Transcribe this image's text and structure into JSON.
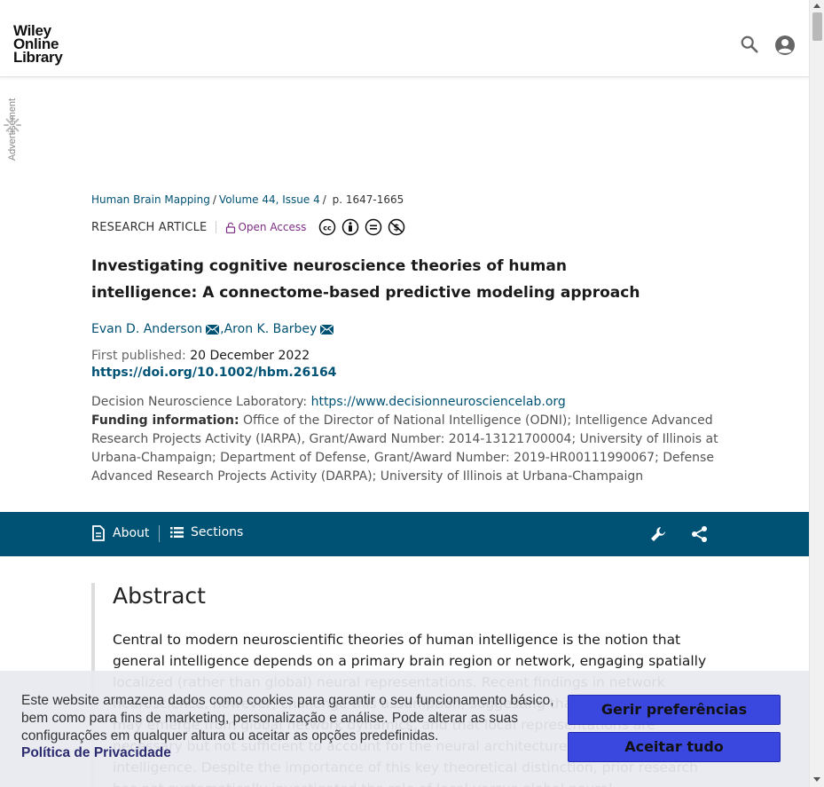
{
  "header": {
    "logo_lines": [
      "Wiley",
      "Online",
      "Library"
    ],
    "search_icon": "search-icon",
    "user_icon": "user-account-icon"
  },
  "ad": {
    "label": "Advertisement"
  },
  "article": {
    "breadcrumb": {
      "journal": "Human Brain Mapping",
      "volume": "Volume 44, Issue 4",
      "pages": "p. 1647-1665"
    },
    "type": "RESEARCH ARTICLE",
    "open_access": "Open Access",
    "license_icons": [
      "cc-icon",
      "by-icon",
      "nd-icon",
      "nc-icon"
    ],
    "title": "Investigating cognitive neuroscience theories of human intelligence: A connectome-based predictive modeling approach",
    "authors": [
      {
        "name": "Evan D. Anderson",
        "sep": ""
      },
      {
        "name": "Aron K. Barbey",
        "sep": ", "
      }
    ],
    "first_published_label": "First published: ",
    "first_published": "20 December 2022",
    "doi": "https://doi.org/10.1002/hbm.26164",
    "affiliation_label": "Decision Neuroscience Laboratory: ",
    "affiliation_url": "https://www.decisionneurosciencelab.org",
    "funding_label": "Funding information:",
    "funding_text": " Office of the Director of National Intelligence (ODNI); Intelligence Advanced Research Projects Activity (IARPA), Grant/Award Number: 2014-13121700004; University of Illinois at Urbana-Champaign; Department of Defense, Grant/Award Number: 2019-HR00111990067; Defense Advanced Research Projects Activity (DARPA); University of Illinois at Urbana-Champaign"
  },
  "section_bar": {
    "about": "About",
    "sections": "Sections",
    "tools_icon": "wrench-icon",
    "share_icon": "share-icon"
  },
  "abstract": {
    "heading": "Abstract",
    "text": "Central to modern neuroscientific theories of human intelligence is the notion that general intelligence depends on a primary brain region or network, engaging spatially localized (rather than global) neural representations. Recent findings in network neuroscience, however, challenge this assumption, suggesting that general intelligence may emerge from global network dynamics, and that local representations are necessary but not sufficient to account for the neural architecture of human intelligence. Despite the importance of this key theoretical distinction, prior research has not systematically investigated the role of local versus global neural representations in predicting general intelligence."
  },
  "cookie": {
    "text": "Este website armazena dados como cookies para garantir o seu funcionamento básico, bem como para fins de marketing, personalização e análise. Pode alterar as suas configurações em qualquer altura ou aceitar as opções predefinidas.",
    "privacy_link": "Política de Privacidade",
    "prefs_button": "Gerir preferências",
    "accept_button": "Aceitar tudo"
  }
}
